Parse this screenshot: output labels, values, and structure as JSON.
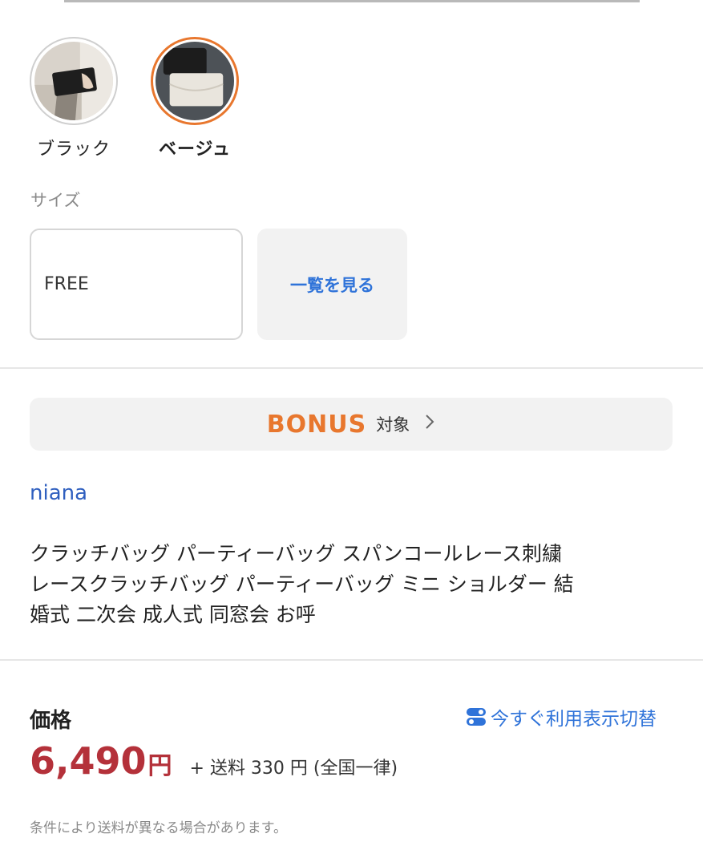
{
  "colors": {
    "accent_orange": "#e8772e",
    "link_blue": "#2f73d9",
    "price_red": "#b4313a"
  },
  "variants": {
    "options": [
      {
        "label": "ブラック",
        "selected": false
      },
      {
        "label": "ベージュ",
        "selected": true
      }
    ]
  },
  "size": {
    "heading": "サイズ",
    "options": [
      {
        "label": "FREE"
      }
    ],
    "see_all_label": "一覧を見る"
  },
  "bonus": {
    "word": "BONUS",
    "target": "対象",
    "arrow_icon": "chevron-right-icon"
  },
  "shop": {
    "name": "niana"
  },
  "product": {
    "title_lines": [
      "クラッチバッグ パーティーバッグ スパンコールレース刺繍",
      "レースクラッチバッグ パーティーバッグ ミニ ショルダー 結",
      "婚式 二次会 成人式 同窓会 お呼"
    ]
  },
  "price": {
    "heading": "価格",
    "switch_icon": "toggle-icon",
    "switch_label": "今すぐ利用表示切替",
    "value": "6,490",
    "unit": "円",
    "shipping": "+ 送料 330 円 (全国一律)",
    "note": "条件により送料が異なる場合があります。"
  }
}
